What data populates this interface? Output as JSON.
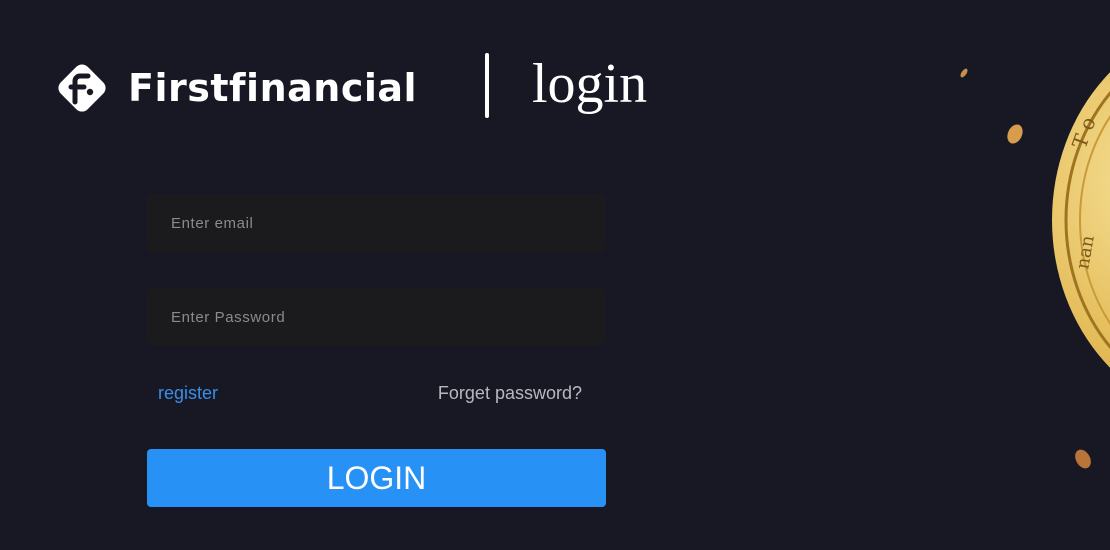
{
  "brand": {
    "name": "Firstfinancial",
    "icon": "firstfinancial-logo-icon"
  },
  "page": {
    "heading": "login"
  },
  "form": {
    "email_placeholder": "Enter email",
    "password_placeholder": "Enter Password",
    "register_label": "register",
    "forgot_label": "Forget password?",
    "login_label": "LOGIN"
  },
  "colors": {
    "background": "#181825",
    "field_background": "#1b1b1d",
    "accent": "#2891f5",
    "register_link": "#3a8ee6",
    "coin_gold": "#e8c25a"
  }
}
